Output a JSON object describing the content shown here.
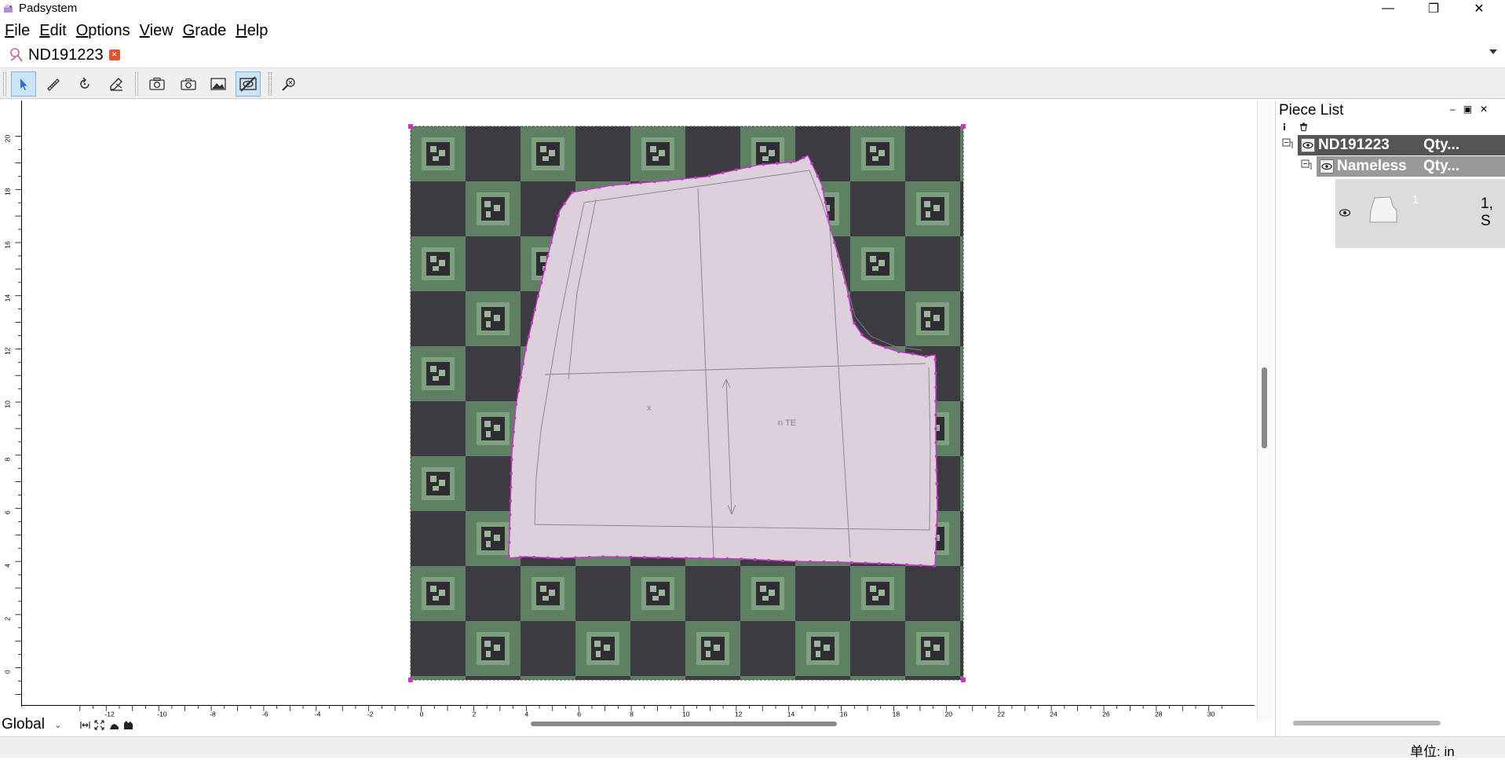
{
  "app": {
    "title": "Padsystem"
  },
  "window_controls": {
    "minimize": "—",
    "maximize": "❐",
    "close": "✕"
  },
  "menu": [
    {
      "label": "File",
      "key": "F",
      "rest": "ile"
    },
    {
      "label": "Edit",
      "key": "E",
      "rest": "dit"
    },
    {
      "label": "Options",
      "key": "O",
      "rest": "ptions"
    },
    {
      "label": "View",
      "key": "V",
      "rest": "iew"
    },
    {
      "label": "Grade",
      "key": "G",
      "rest": "rade"
    },
    {
      "label": "Help",
      "key": "H",
      "rest": "elp"
    }
  ],
  "tab": {
    "label": "ND191223",
    "close_glyph": "×"
  },
  "toolbar": {
    "tools": [
      {
        "name": "select-tool",
        "icon": "arrow-pointer-icon",
        "active": true
      },
      {
        "name": "measure-tool",
        "icon": "ruler-pencil-icon",
        "active": false
      },
      {
        "name": "rotate-tool",
        "icon": "rotate-icon",
        "active": false
      },
      {
        "name": "edit-tool",
        "icon": "edit-pen-icon",
        "active": false
      },
      {
        "name": "camera-settings-tool",
        "icon": "camera-gear-icon",
        "active": false
      },
      {
        "name": "capture-tool",
        "icon": "camera-icon",
        "active": false
      },
      {
        "name": "image-tool",
        "icon": "image-icon",
        "active": false
      },
      {
        "name": "hide-image-tool",
        "icon": "eye-slash-icon",
        "active": true
      },
      {
        "name": "search-piece-tool",
        "icon": "magnifier-icon",
        "active": false
      }
    ]
  },
  "ruler": {
    "left_ticks": [
      "20",
      "18",
      "16",
      "14",
      "12",
      "10",
      "8",
      "6",
      "4",
      "2",
      "0"
    ],
    "bottom_ticks": [
      "-12",
      "-10",
      "-8",
      "-6",
      "-4",
      "-2",
      "0",
      "2",
      "4",
      "6",
      "8",
      "10",
      "12",
      "14",
      "16",
      "18",
      "20",
      "22",
      "24",
      "26",
      "28",
      "30"
    ]
  },
  "status": {
    "scope": "Global",
    "unit_label": "单位: in"
  },
  "panel": {
    "title": "Piece List",
    "controls": {
      "minimize": "–",
      "restore": "▣",
      "close": "✕"
    },
    "mini_icons": [
      "info-icon",
      "trash-icon"
    ],
    "root": {
      "name": "ND191223",
      "qty": "Qty..."
    },
    "child": {
      "name": "Nameless",
      "qty": "Qty..."
    },
    "piece": {
      "index": "1",
      "size": "1, S"
    }
  }
}
